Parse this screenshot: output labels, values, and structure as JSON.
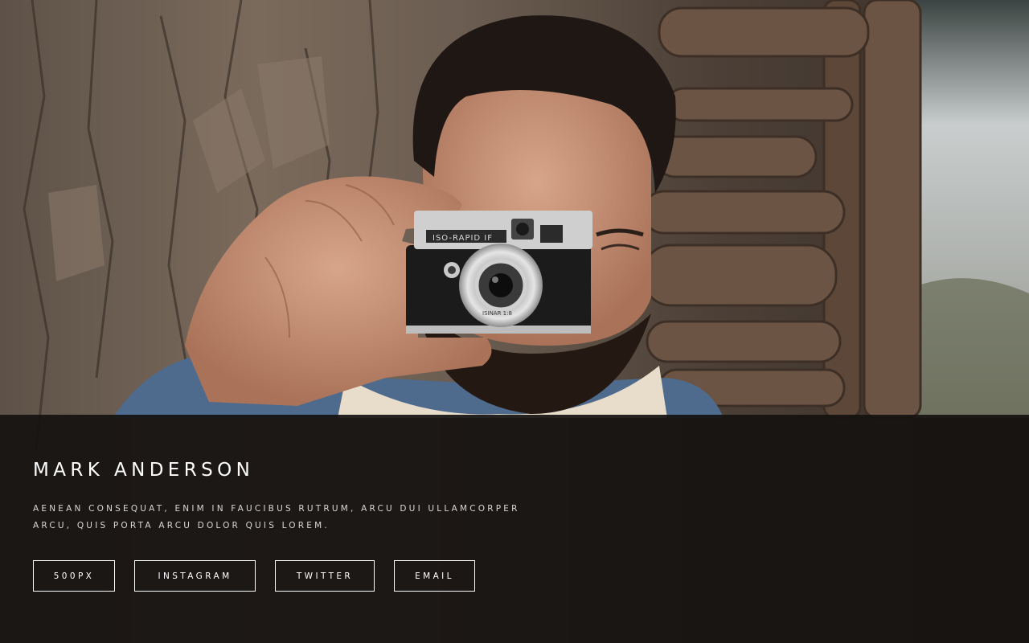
{
  "profile": {
    "name": "MARK ANDERSON",
    "bio_line1": "AENEAN CONSEQUAT, ENIM IN FAUCIBUS RUTRUM, ARCU DUI ULLAMCORPER",
    "bio_line2": "ARCU, QUIS PORTA ARCU DOLOR QUIS LOREM."
  },
  "links": [
    {
      "label": "500PX"
    },
    {
      "label": "INSTAGRAM"
    },
    {
      "label": "TWITTER"
    },
    {
      "label": "EMAIL"
    }
  ],
  "photo": {
    "camera_model_text": "ISO-RAPID IF",
    "lens_text": "ISINAR 1:8"
  },
  "colors": {
    "panel_background": "#161210",
    "text": "#ffffff",
    "button_border": "#ffffff"
  }
}
